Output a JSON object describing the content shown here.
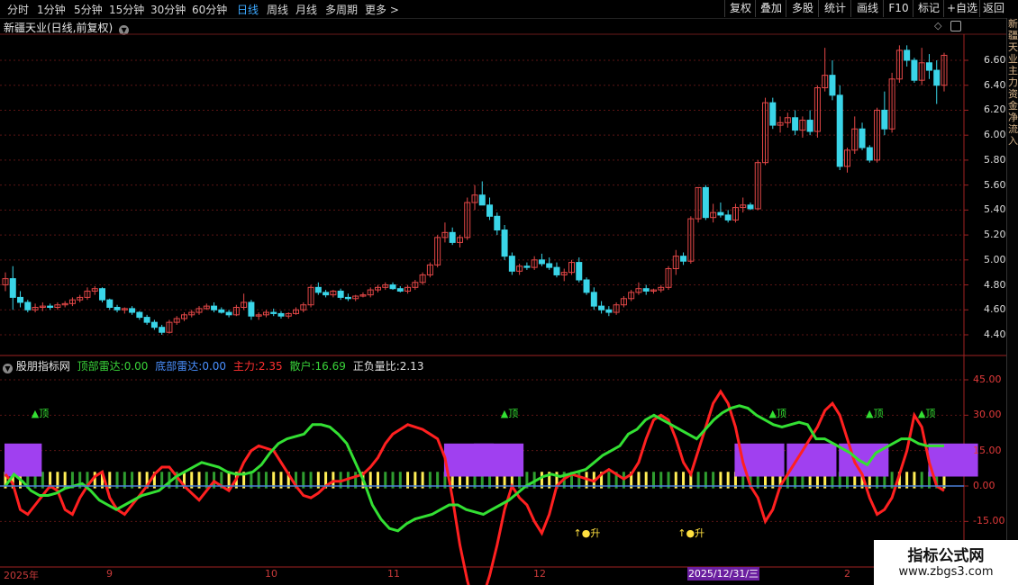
{
  "tabs": [
    "分时",
    "1分钟",
    "5分钟",
    "15分钟",
    "30分钟",
    "60分钟",
    "日线",
    "周线",
    "月线",
    "多周期",
    "更多 >"
  ],
  "active_tab": "日线",
  "right_buttons": [
    "复权",
    "叠加",
    "多股",
    "统计",
    "画线",
    "F10",
    "标记",
    "+自选",
    "返回"
  ],
  "stock_title": "新疆天业(日线,前复权)",
  "indicator": {
    "name": "股朋指标网",
    "items": [
      {
        "label": "顶部雷达:",
        "value": "0.00",
        "color": "#39d339"
      },
      {
        "label": "底部雷达:",
        "value": "0.00",
        "color": "#4a90ff"
      },
      {
        "label": "主力:",
        "value": "2.35",
        "color": "#ff3030"
      },
      {
        "label": "散户:",
        "value": "16.69",
        "color": "#39d339"
      },
      {
        "label": "正负量比:",
        "value": "2.13",
        "color": "#e0e0e0"
      }
    ]
  },
  "price_axis": [
    "6.60",
    "6.40",
    "6.20",
    "6.00",
    "5.80",
    "5.60",
    "5.40",
    "5.20",
    "5.00",
    "4.80",
    "4.60",
    "4.40"
  ],
  "indicator_axis": [
    "45.00",
    "30.00",
    "15.00",
    "0.00",
    "-15.00"
  ],
  "x_axis": {
    "labels": [
      "2025年",
      "9",
      "10",
      "11",
      "12",
      "2"
    ],
    "highlight": "2025/12/31/三"
  },
  "annotations": {
    "top": "▲顶",
    "bottom": "↑●升"
  },
  "sidebar_text": "新疆天业主力资金净流入",
  "watermark": {
    "line1": "指标公式网",
    "line2": "www.zbgs3.com"
  },
  "colors": {
    "up": "#e34747",
    "down": "#3ad5e8",
    "main": "#ff2020",
    "retail": "#33e033",
    "purple": "#a040f0",
    "bar_yellow": "#ffee55",
    "bar_green": "#2f9e2f"
  },
  "chart_data": {
    "type": "candlestick",
    "ylim": [
      4.35,
      6.7
    ],
    "ohlc": [
      [
        4.8,
        4.9,
        4.75,
        4.85
      ],
      [
        4.85,
        4.95,
        4.6,
        4.7
      ],
      [
        4.7,
        4.75,
        4.62,
        4.66
      ],
      [
        4.66,
        4.68,
        4.58,
        4.6
      ],
      [
        4.6,
        4.65,
        4.58,
        4.62
      ],
      [
        4.62,
        4.66,
        4.59,
        4.63
      ],
      [
        4.63,
        4.65,
        4.6,
        4.62
      ],
      [
        4.62,
        4.66,
        4.6,
        4.64
      ],
      [
        4.64,
        4.67,
        4.62,
        4.65
      ],
      [
        4.65,
        4.7,
        4.63,
        4.68
      ],
      [
        4.68,
        4.72,
        4.66,
        4.7
      ],
      [
        4.7,
        4.78,
        4.68,
        4.75
      ],
      [
        4.75,
        4.79,
        4.72,
        4.77
      ],
      [
        4.77,
        4.78,
        4.66,
        4.68
      ],
      [
        4.68,
        4.69,
        4.6,
        4.62
      ],
      [
        4.62,
        4.64,
        4.58,
        4.6
      ],
      [
        4.6,
        4.62,
        4.57,
        4.61
      ],
      [
        4.61,
        4.63,
        4.56,
        4.58
      ],
      [
        4.58,
        4.59,
        4.52,
        4.54
      ],
      [
        4.54,
        4.56,
        4.48,
        4.5
      ],
      [
        4.5,
        4.52,
        4.44,
        4.46
      ],
      [
        4.46,
        4.48,
        4.4,
        4.42
      ],
      [
        4.42,
        4.52,
        4.41,
        4.5
      ],
      [
        4.5,
        4.55,
        4.48,
        4.53
      ],
      [
        4.53,
        4.58,
        4.51,
        4.56
      ],
      [
        4.56,
        4.6,
        4.54,
        4.58
      ],
      [
        4.58,
        4.63,
        4.56,
        4.61
      ],
      [
        4.61,
        4.65,
        4.6,
        4.63
      ],
      [
        4.63,
        4.66,
        4.58,
        4.6
      ],
      [
        4.6,
        4.62,
        4.57,
        4.58
      ],
      [
        4.58,
        4.6,
        4.54,
        4.56
      ],
      [
        4.56,
        4.64,
        4.55,
        4.62
      ],
      [
        4.62,
        4.73,
        4.6,
        4.66
      ],
      [
        4.66,
        4.68,
        4.52,
        4.55
      ],
      [
        4.55,
        4.58,
        4.52,
        4.56
      ],
      [
        4.56,
        4.6,
        4.54,
        4.58
      ],
      [
        4.58,
        4.61,
        4.55,
        4.57
      ],
      [
        4.57,
        4.59,
        4.53,
        4.55
      ],
      [
        4.55,
        4.58,
        4.53,
        4.57
      ],
      [
        4.57,
        4.62,
        4.56,
        4.6
      ],
      [
        4.6,
        4.66,
        4.58,
        4.64
      ],
      [
        4.64,
        4.8,
        4.62,
        4.78
      ],
      [
        4.78,
        4.82,
        4.72,
        4.74
      ],
      [
        4.74,
        4.76,
        4.7,
        4.72
      ],
      [
        4.72,
        4.76,
        4.7,
        4.75
      ],
      [
        4.75,
        4.77,
        4.68,
        4.7
      ],
      [
        4.7,
        4.73,
        4.67,
        4.69
      ],
      [
        4.69,
        4.72,
        4.67,
        4.71
      ],
      [
        4.71,
        4.74,
        4.7,
        4.72
      ],
      [
        4.72,
        4.78,
        4.7,
        4.76
      ],
      [
        4.76,
        4.8,
        4.74,
        4.78
      ],
      [
        4.78,
        4.82,
        4.76,
        4.8
      ],
      [
        4.8,
        4.82,
        4.76,
        4.77
      ],
      [
        4.77,
        4.79,
        4.74,
        4.75
      ],
      [
        4.75,
        4.8,
        4.73,
        4.78
      ],
      [
        4.78,
        4.84,
        4.76,
        4.82
      ],
      [
        4.82,
        4.9,
        4.8,
        4.88
      ],
      [
        4.88,
        4.98,
        4.86,
        4.96
      ],
      [
        4.96,
        5.2,
        4.94,
        5.18
      ],
      [
        5.18,
        5.3,
        5.14,
        5.22
      ],
      [
        5.22,
        5.26,
        5.12,
        5.14
      ],
      [
        5.14,
        5.2,
        5.1,
        5.18
      ],
      [
        5.18,
        5.5,
        5.16,
        5.46
      ],
      [
        5.46,
        5.6,
        5.4,
        5.52
      ],
      [
        5.52,
        5.63,
        5.48,
        5.44
      ],
      [
        5.44,
        5.5,
        5.32,
        5.35
      ],
      [
        5.35,
        5.38,
        5.2,
        5.24
      ],
      [
        5.24,
        5.28,
        5.0,
        5.03
      ],
      [
        5.03,
        5.06,
        4.88,
        4.91
      ],
      [
        4.91,
        4.97,
        4.88,
        4.95
      ],
      [
        4.95,
        4.98,
        4.92,
        4.94
      ],
      [
        4.94,
        5.03,
        4.92,
        5.0
      ],
      [
        5.0,
        5.05,
        4.95,
        4.97
      ],
      [
        4.97,
        5.02,
        4.92,
        4.94
      ],
      [
        4.94,
        4.98,
        4.86,
        4.88
      ],
      [
        4.88,
        4.93,
        4.83,
        4.9
      ],
      [
        4.9,
        5.0,
        4.88,
        4.98
      ],
      [
        4.98,
        5.02,
        4.82,
        4.84
      ],
      [
        4.84,
        4.86,
        4.72,
        4.74
      ],
      [
        4.74,
        4.78,
        4.6,
        4.63
      ],
      [
        4.63,
        4.67,
        4.57,
        4.6
      ],
      [
        4.6,
        4.63,
        4.55,
        4.58
      ],
      [
        4.58,
        4.66,
        4.56,
        4.64
      ],
      [
        4.64,
        4.71,
        4.62,
        4.69
      ],
      [
        4.69,
        4.76,
        4.67,
        4.74
      ],
      [
        4.74,
        4.82,
        4.72,
        4.77
      ],
      [
        4.77,
        4.8,
        4.72,
        4.75
      ],
      [
        4.75,
        4.77,
        4.73,
        4.76
      ],
      [
        4.76,
        4.8,
        4.74,
        4.78
      ],
      [
        4.78,
        4.95,
        4.76,
        4.93
      ],
      [
        4.93,
        5.08,
        4.88,
        5.03
      ],
      [
        5.03,
        5.06,
        4.96,
        4.99
      ],
      [
        4.99,
        5.35,
        4.97,
        5.33
      ],
      [
        5.33,
        5.58,
        5.3,
        5.58
      ],
      [
        5.58,
        5.6,
        5.32,
        5.34
      ],
      [
        5.34,
        5.45,
        5.3,
        5.38
      ],
      [
        5.38,
        5.46,
        5.34,
        5.36
      ],
      [
        5.36,
        5.4,
        5.3,
        5.32
      ],
      [
        5.32,
        5.45,
        5.3,
        5.42
      ],
      [
        5.42,
        5.5,
        5.38,
        5.44
      ],
      [
        5.44,
        5.46,
        5.4,
        5.41
      ],
      [
        5.41,
        5.8,
        5.4,
        5.78
      ],
      [
        5.78,
        6.3,
        5.76,
        6.26
      ],
      [
        6.26,
        6.3,
        6.05,
        6.08
      ],
      [
        6.08,
        6.15,
        6.02,
        6.1
      ],
      [
        6.1,
        6.18,
        6.06,
        6.14
      ],
      [
        6.14,
        6.2,
        6.0,
        6.04
      ],
      [
        6.04,
        6.15,
        5.98,
        6.12
      ],
      [
        6.12,
        6.2,
        6.0,
        6.03
      ],
      [
        6.03,
        6.4,
        5.98,
        6.38
      ],
      [
        6.38,
        6.7,
        6.35,
        6.48
      ],
      [
        6.48,
        6.6,
        6.28,
        6.32
      ],
      [
        6.32,
        6.4,
        5.72,
        5.75
      ],
      [
        5.75,
        5.9,
        5.7,
        5.88
      ],
      [
        5.88,
        6.15,
        5.85,
        6.05
      ],
      [
        6.05,
        6.1,
        5.88,
        5.9
      ],
      [
        5.9,
        5.92,
        5.78,
        5.8
      ],
      [
        5.8,
        6.22,
        5.78,
        6.2
      ],
      [
        6.2,
        6.35,
        6.0,
        6.05
      ],
      [
        6.05,
        6.5,
        6.02,
        6.45
      ],
      [
        6.45,
        6.72,
        6.42,
        6.68
      ],
      [
        6.68,
        6.72,
        6.55,
        6.6
      ],
      [
        6.6,
        6.62,
        6.42,
        6.44
      ],
      [
        6.44,
        6.7,
        6.4,
        6.58
      ],
      [
        6.58,
        6.65,
        6.45,
        6.52
      ],
      [
        6.52,
        6.6,
        6.25,
        6.4
      ],
      [
        6.4,
        6.66,
        6.35,
        6.64
      ]
    ],
    "main_force": [
      5,
      1,
      -10,
      -12,
      -8,
      -4,
      0,
      -2,
      -10,
      -12,
      -5,
      0,
      4,
      6,
      -5,
      -10,
      -12,
      -8,
      -4,
      0,
      5,
      8,
      8,
      4,
      0,
      -3,
      -6,
      -2,
      2,
      0,
      -2,
      3,
      10,
      15,
      17,
      16,
      15,
      10,
      5,
      0,
      -4,
      -5,
      -3,
      0,
      2,
      2,
      3,
      4,
      5,
      8,
      12,
      18,
      22,
      24,
      26,
      25,
      24,
      22,
      20,
      12,
      -5,
      -25,
      -40,
      -52,
      -48,
      -38,
      -25,
      -10,
      0,
      -5,
      -8,
      -15,
      -20,
      -12,
      0,
      3,
      5,
      4,
      3,
      2,
      5,
      7,
      5,
      3,
      5,
      10,
      20,
      28,
      30,
      28,
      20,
      10,
      5,
      15,
      25,
      35,
      40,
      35,
      25,
      10,
      0,
      -5,
      -15,
      -10,
      0,
      5,
      10,
      15,
      20,
      25,
      32,
      35,
      30,
      20,
      10,
      5,
      -5,
      -12,
      -10,
      -5,
      5,
      15,
      30,
      25,
      10,
      0,
      -2
    ],
    "retail": [
      0,
      5,
      2,
      -2,
      -4,
      -4,
      -3,
      -1,
      0,
      1,
      -2,
      -6,
      -8,
      -10,
      -8,
      -6,
      -4,
      -3,
      -2,
      1,
      4,
      6,
      8,
      10,
      9,
      8,
      6,
      5,
      5,
      6,
      9,
      14,
      18,
      20,
      21,
      22,
      26,
      26,
      25,
      22,
      18,
      10,
      2,
      -8,
      -14,
      -18,
      -19,
      -16,
      -14,
      -13,
      -12,
      -10,
      -8,
      -8,
      -10,
      -11,
      -12,
      -10,
      -8,
      -6,
      -3,
      0,
      2,
      4,
      5,
      4,
      5,
      6,
      7,
      10,
      13,
      15,
      17,
      22,
      24,
      28,
      30,
      28,
      26,
      24,
      22,
      20,
      24,
      28,
      31,
      33,
      34,
      33,
      30,
      28,
      26,
      25,
      26,
      27,
      26,
      20,
      20,
      18,
      16,
      14,
      11,
      9,
      14,
      16,
      18,
      20,
      20,
      18,
      17,
      17,
      17
    ],
    "bars": [
      [
        1,
        -4,
        12
      ],
      [
        10,
        -4,
        6
      ],
      [
        20,
        -4,
        4
      ],
      [
        30,
        -4,
        6
      ],
      [
        40,
        -4,
        6
      ],
      [
        50,
        -4,
        5
      ],
      [
        60,
        -4,
        6
      ],
      [
        70,
        -4,
        8
      ],
      [
        80,
        -4,
        6
      ],
      [
        90,
        -4,
        6
      ],
      [
        100,
        -4,
        5
      ],
      [
        110,
        -4,
        10
      ],
      [
        120,
        -4,
        9
      ],
      [
        130,
        -4,
        8
      ]
    ],
    "purple_blocks": [
      [
        0,
        18,
        6
      ],
      [
        59,
        18,
        8
      ],
      [
        63,
        18,
        8
      ],
      [
        98,
        18,
        8
      ],
      [
        105,
        18,
        8
      ],
      [
        112,
        18,
        8
      ],
      [
        124,
        18,
        8
      ]
    ],
    "top_marks": [
      3,
      66,
      102,
      115,
      122
    ],
    "up_marks": [
      76,
      90
    ]
  }
}
